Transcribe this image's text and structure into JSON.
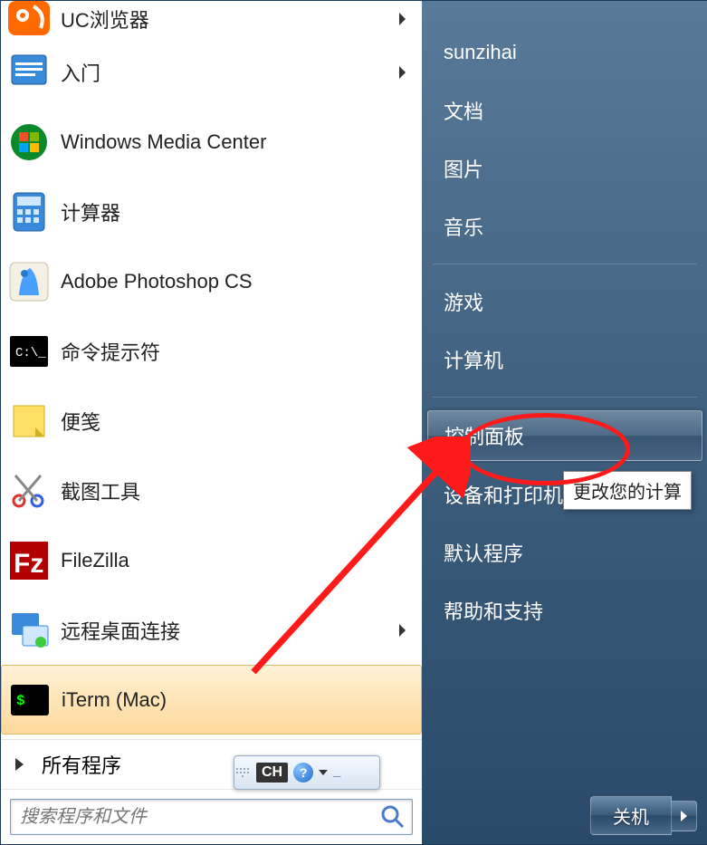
{
  "left_programs": [
    {
      "label": "UC浏览器",
      "icon": "uc",
      "has_sub": true
    },
    {
      "label": "入门",
      "icon": "get-started",
      "has_sub": true
    },
    {
      "label": "Windows Media Center",
      "icon": "wmc",
      "has_sub": false
    },
    {
      "label": "计算器",
      "icon": "calculator",
      "has_sub": false
    },
    {
      "label": "Adobe Photoshop CS",
      "icon": "photoshop",
      "has_sub": false
    },
    {
      "label": "命令提示符",
      "icon": "cmd",
      "has_sub": false
    },
    {
      "label": "便笺",
      "icon": "sticky-notes",
      "has_sub": false
    },
    {
      "label": "截图工具",
      "icon": "snipping",
      "has_sub": false
    },
    {
      "label": "FileZilla",
      "icon": "filezilla",
      "has_sub": false
    },
    {
      "label": "远程桌面连接",
      "icon": "rdp",
      "has_sub": true
    },
    {
      "label": "iTerm (Mac)",
      "icon": "iterm",
      "has_sub": false,
      "selected": true
    }
  ],
  "all_programs_label": "所有程序",
  "search_placeholder": "搜索程序和文件",
  "right_items_top": [
    {
      "label": "sunzihai"
    },
    {
      "label": "文档"
    },
    {
      "label": "图片"
    },
    {
      "label": "音乐"
    }
  ],
  "right_items_mid": [
    {
      "label": "游戏"
    },
    {
      "label": "计算机"
    }
  ],
  "right_items_bot": [
    {
      "label": "控制面板",
      "highlighted": true
    },
    {
      "label": "设备和打印机"
    },
    {
      "label": "默认程序"
    },
    {
      "label": "帮助和支持"
    }
  ],
  "shutdown_label": "关机",
  "tooltip_text": "更改您的计算",
  "lang_indicator": "CH"
}
